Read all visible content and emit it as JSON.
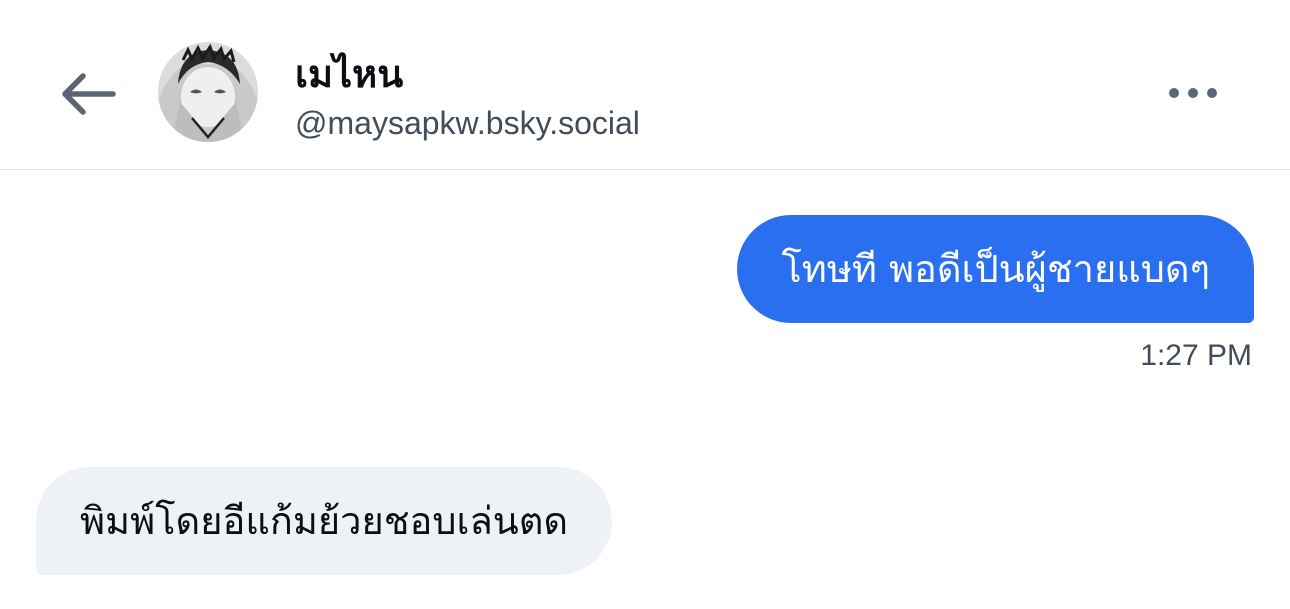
{
  "header": {
    "back_icon": "arrow-left-icon",
    "avatar_icon": "avatar-image",
    "display_name": "เมไหน",
    "handle": "@maysapkw.bsky.social",
    "more_icon": "ellipsis-horizontal-icon"
  },
  "messages": [
    {
      "direction": "outgoing",
      "text": "โทษที พอดีเป็นผู้ชายแบดๆ",
      "time": "1:27 PM"
    },
    {
      "direction": "incoming",
      "text": "พิมพ์โดยอีแก้มย้วยชอบเล่นตด"
    }
  ],
  "colors": {
    "outgoing_bubble": "#2a6ff0",
    "incoming_bubble": "#eef1f5",
    "secondary_text": "#424c5a",
    "divider": "#e3e6ea"
  }
}
